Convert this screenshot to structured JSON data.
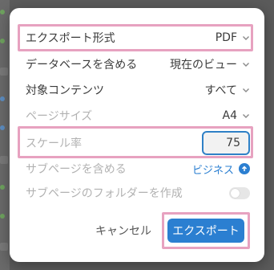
{
  "dialog": {
    "rows": [
      {
        "label": "エクスポート形式",
        "value": "PDF"
      },
      {
        "label": "データベースを含める",
        "value": "現在のビュー"
      },
      {
        "label": "対象コンテンツ",
        "value": "すべて"
      },
      {
        "label": "ページサイズ",
        "value": "A4"
      },
      {
        "label": "スケール率",
        "value": "75"
      },
      {
        "label": "サブページを含める",
        "value": "ビジネス"
      },
      {
        "label": "サブページのフォルダーを作成"
      }
    ],
    "create_subpage_folders_enabled": false,
    "cancel_label": "キャンセル",
    "export_label": "エクスポート"
  },
  "colors": {
    "accent": "#2b7fd1",
    "highlight": "#e7a2c0",
    "muted_text": "#b2b2b2"
  }
}
